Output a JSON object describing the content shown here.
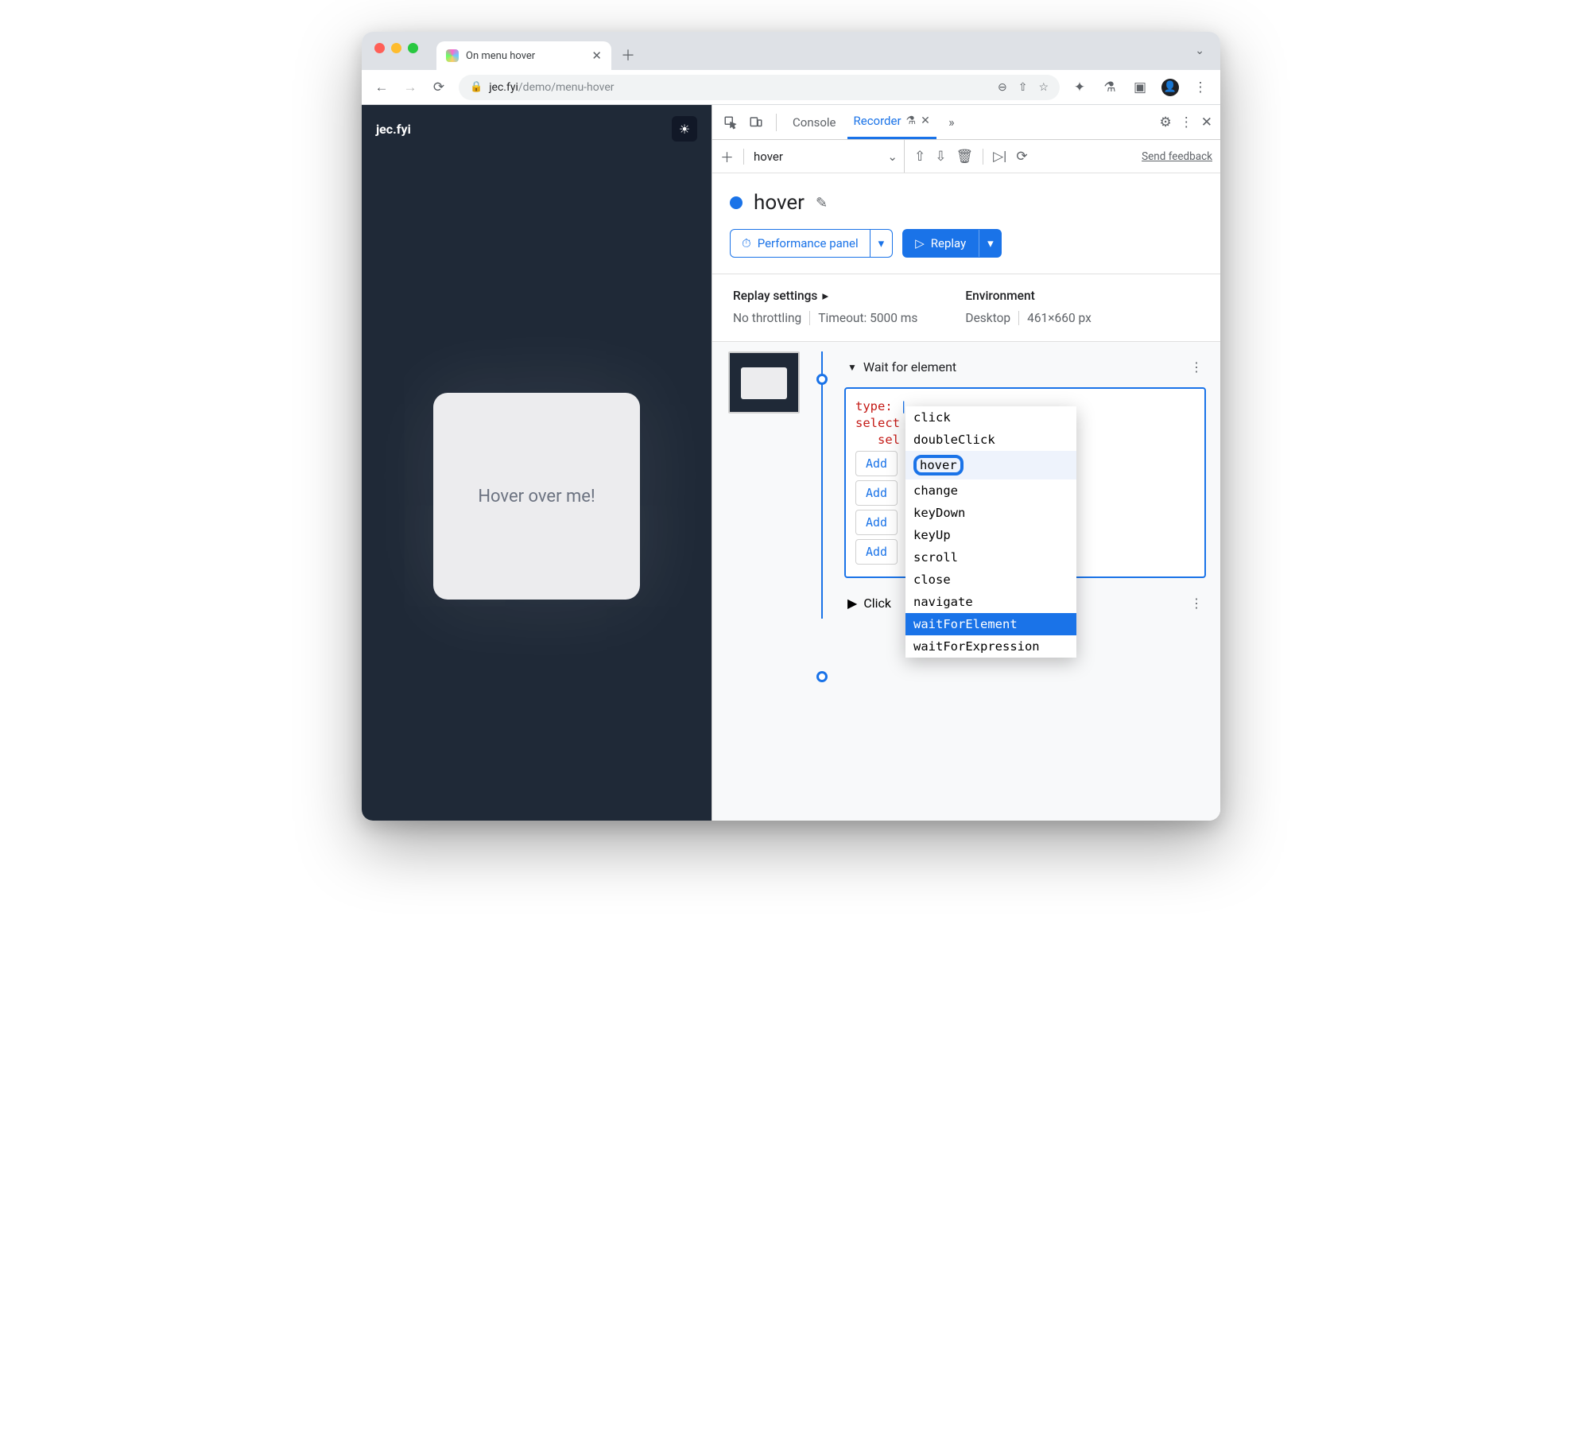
{
  "browser": {
    "tab_title": "On menu hover",
    "url_domain": "jec.fyi",
    "url_path": "/demo/menu-hover"
  },
  "page": {
    "site_title": "jec.fyi",
    "card_text": "Hover over me!"
  },
  "devtools": {
    "tabs": {
      "console": "Console",
      "recorder": "Recorder"
    },
    "recorder_name": "hover",
    "feedback": "Send feedback",
    "rec_title": "hover",
    "buttons": {
      "perf": "Performance panel",
      "replay": "Replay"
    },
    "settings": {
      "replay_hdr": "Replay settings",
      "throttling": "No throttling",
      "timeout": "Timeout: 5000 ms",
      "env_hdr": "Environment",
      "device": "Desktop",
      "viewport": "461×660 px"
    },
    "step1": {
      "title": "Wait for element",
      "type_key": "type:",
      "selectors_key": "select",
      "sel_key": "sel"
    },
    "add_labels": [
      "Add",
      "Add",
      "Add",
      "Add"
    ],
    "dropdown": {
      "items": [
        "click",
        "doubleClick",
        "hover",
        "change",
        "keyDown",
        "keyUp",
        "scroll",
        "close",
        "navigate",
        "waitForElement",
        "waitForExpression"
      ]
    },
    "step2": {
      "title": "Click"
    }
  }
}
